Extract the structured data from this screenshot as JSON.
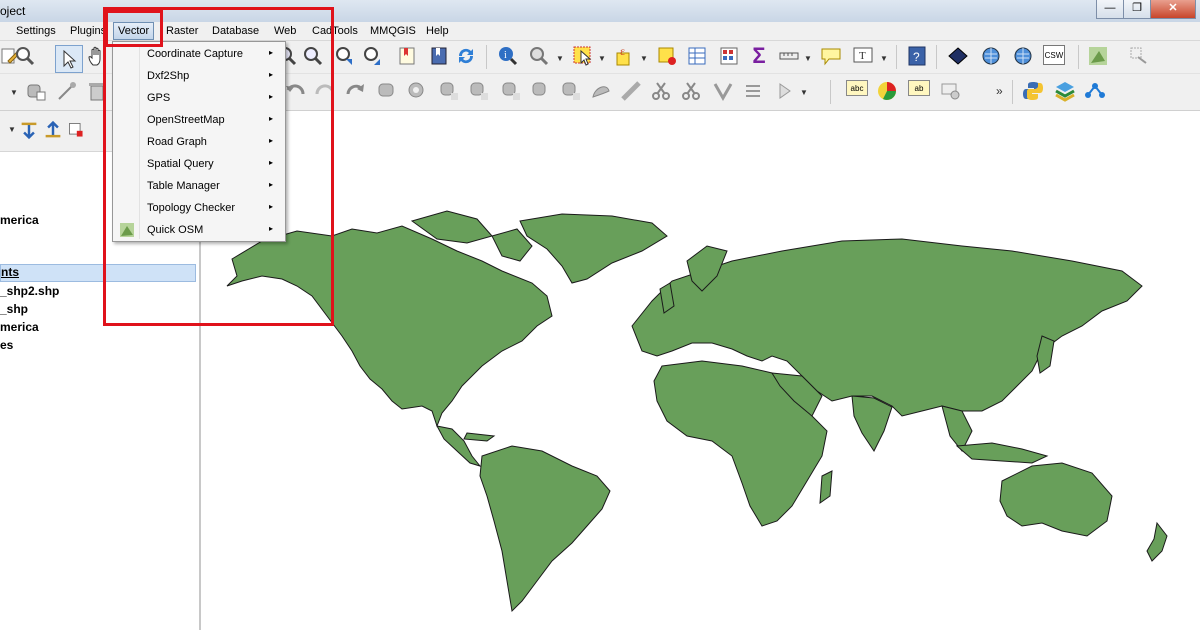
{
  "window": {
    "title_fragment": "oject",
    "buttons": [
      "—",
      "❐",
      "✕"
    ]
  },
  "menubar": {
    "items": [
      "Settings",
      "Plugins",
      "Vector",
      "Raster",
      "Database",
      "Web",
      "CadTools",
      "MMQGIS",
      "Help"
    ],
    "active": "Vector"
  },
  "toolbar": {
    "sum_glyph": "Σ",
    "csw_label": "CSW",
    "abc_label": "abc",
    "ab_label": "ab",
    "overflow_glyph": "»"
  },
  "layers_panel": {
    "items": [
      "merica",
      "",
      "nts",
      "_shp2.shp",
      "_shp",
      "merica",
      "es"
    ],
    "selected_index": 2
  },
  "vector_menu": {
    "items": [
      {
        "label": "Coordinate Capture",
        "submenu": true
      },
      {
        "label": "Dxf2Shp",
        "submenu": true
      },
      {
        "label": "GPS",
        "submenu": true
      },
      {
        "label": "OpenStreetMap",
        "submenu": true
      },
      {
        "label": "Road Graph",
        "submenu": true
      },
      {
        "label": "Spatial Query",
        "submenu": true
      },
      {
        "label": "Table Manager",
        "submenu": true
      },
      {
        "label": "Topology Checker",
        "submenu": true
      },
      {
        "label": "Quick OSM",
        "submenu": true,
        "icon": "quick-osm-icon"
      }
    ],
    "arrow_glyph": "▸"
  },
  "map": {
    "land_color": "#689f5a",
    "outline_color": "#1a1a1a"
  },
  "annotation": {
    "color": "#e0121b"
  }
}
